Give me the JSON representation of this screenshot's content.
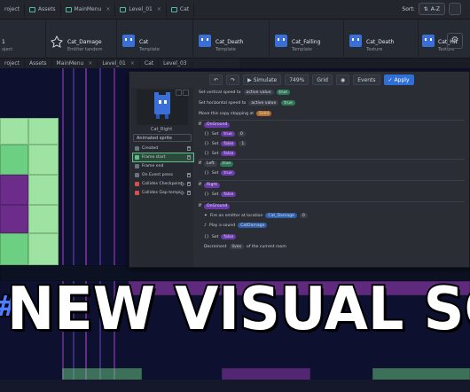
{
  "top_tabs": [
    {
      "label": "roject"
    },
    {
      "label": "Assets"
    },
    {
      "label": "MainMenu"
    },
    {
      "label": "Level_01"
    },
    {
      "label": "Cat"
    }
  ],
  "sort": {
    "label": "Sort:",
    "value": "A-Z"
  },
  "objects": [
    {
      "name": "1",
      "sub": ""
    },
    {
      "name": "Cat_Damage",
      "sub": "Emitter tandem"
    },
    {
      "name": "Cat",
      "sub": "Template"
    },
    {
      "name": "Cat_Death",
      "sub": "Template"
    },
    {
      "name": "Cat_Falling",
      "sub": "Template"
    },
    {
      "name": "Cat_Death",
      "sub": "Texture"
    },
    {
      "name": "Cat_Hit",
      "sub": "Texture"
    }
  ],
  "second_tabs": [
    {
      "label": "roject"
    },
    {
      "label": "Assets"
    },
    {
      "label": "MainMenu"
    },
    {
      "label": "Level_01"
    },
    {
      "label": "Cat"
    },
    {
      "label": "Level_03"
    }
  ],
  "editor": {
    "toolbar": {
      "simulate": "Simulate",
      "zoom": "749%",
      "grid": "Grid",
      "events": "Events",
      "apply": "Apply"
    },
    "character_name": "Cat_Right",
    "anim_select": "Animated sprite",
    "events": [
      {
        "label": "Created"
      },
      {
        "label": "Frame start"
      },
      {
        "label": "Frame end"
      },
      {
        "label": "On Event press"
      },
      {
        "label": "Collides Checkpoint..."
      },
      {
        "label": "Collides Gap templ..."
      }
    ],
    "rows": [
      "Set vertical speed to",
      "Set horizontal speed to",
      "Move this copy stopping at",
      "If",
      "Set",
      "Set",
      "Set",
      "If",
      "Set",
      "If",
      "Set",
      "If",
      "Fire an emitter at location",
      "Play a sound",
      "Set",
      "Decrement"
    ],
    "pills": {
      "vspeed": "active value",
      "hspeed": "active value",
      "stop": "Solid",
      "collided": "OnGround",
      "cat_damage": "Cat_Damage",
      "sound": "CatDamage",
      "true": "true",
      "false": "false",
      "left": "Left",
      "right": "Right",
      "zero": "0",
      "one": "1",
      "lives": "lives",
      "of_room": "of the current room"
    }
  },
  "title": {
    "hash": "#",
    "text": "NEW VISUAL SCRIPT"
  },
  "colors": {
    "accent": "#2f6fd8",
    "green": "#6ccf82",
    "purple": "#6b2c8a",
    "dark_bg": "#0e1030"
  }
}
